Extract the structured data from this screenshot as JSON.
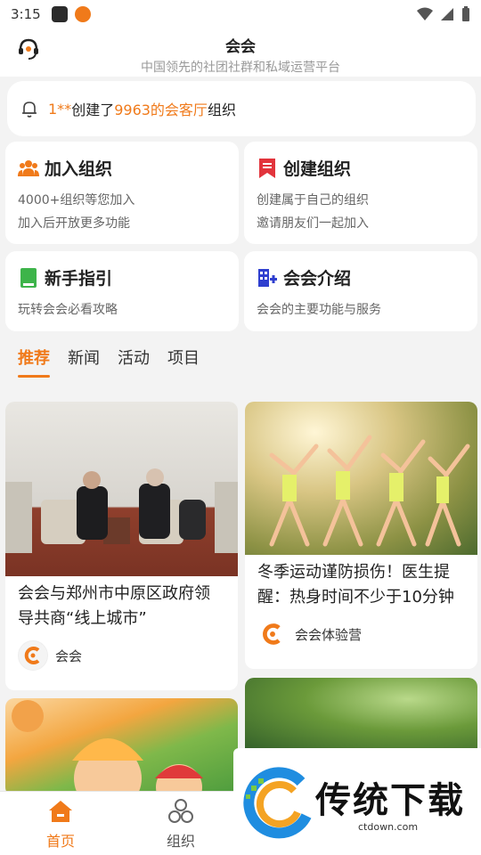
{
  "status_bar": {
    "time": "3:15"
  },
  "header": {
    "title": "会会",
    "subtitle": "中国领先的社团社群和私域运营平台"
  },
  "notice": {
    "prefix": "1**",
    "mid1": "创建了",
    "highlight": "9963的会客厅",
    "suffix": "组织"
  },
  "cards": [
    {
      "title": "加入组织",
      "lines": [
        "4000+组织等您加入",
        "加入后开放更多功能"
      ],
      "icon": "group-icon"
    },
    {
      "title": "创建组织",
      "lines": [
        "创建属于自己的组织",
        "邀请朋友们一起加入"
      ],
      "icon": "bookmark-icon"
    },
    {
      "title": "新手指引",
      "lines": [
        "玩转会会必看攻略"
      ],
      "icon": "book-icon"
    },
    {
      "title": "会会介绍",
      "lines": [
        "会会的主要功能与服务"
      ],
      "icon": "building-icon"
    }
  ],
  "tabs": [
    "推荐",
    "新闻",
    "活动",
    "项目"
  ],
  "feed": [
    {
      "title": "会会与郑州市中原区政府领导共商“线上城市”",
      "author": "会会"
    },
    {
      "title": "冬季运动谨防损伤！医生提醒：热身时间不少于10分钟",
      "author": "会会体验营"
    }
  ],
  "bottom_nav": [
    "首页",
    "组织"
  ],
  "watermark": {
    "text": "传统下载",
    "url": "ctdown.com"
  },
  "colors": {
    "accent": "#f07a1a",
    "background": "#f3f3f3"
  }
}
